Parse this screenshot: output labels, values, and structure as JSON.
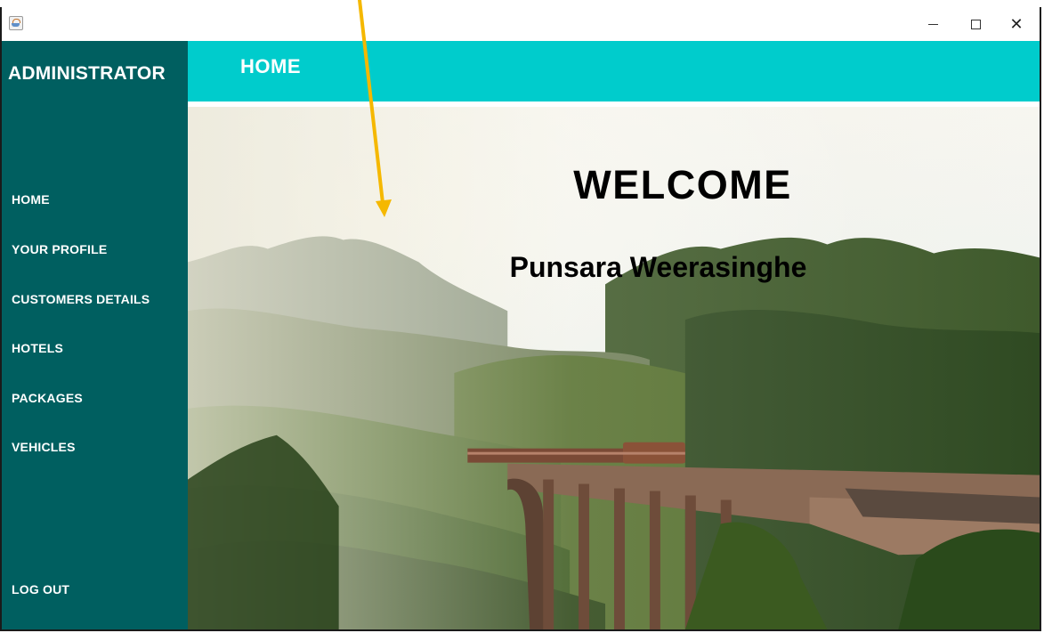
{
  "window": {
    "app_icon": "java-cup-icon",
    "controls": {
      "minimize_icon": "minimize-icon",
      "maximize_icon": "maximize-icon",
      "close_icon": "close-icon",
      "close_glyph": "✕"
    }
  },
  "sidebar": {
    "title": "ADMINISTRATOR",
    "items": [
      {
        "label": "HOME"
      },
      {
        "label": "YOUR PROFILE"
      },
      {
        "label": "CUSTOMERS DETAILS"
      },
      {
        "label": "HOTELS"
      },
      {
        "label": "PACKAGES"
      },
      {
        "label": "VEHICLES"
      }
    ],
    "logout_label": "LOG OUT"
  },
  "header": {
    "title": "HOME"
  },
  "main": {
    "welcome_text": "WELCOME",
    "user_name": "Punsara Weerasinghe",
    "background_image": "train-on-arched-bridge-through-forest-photo"
  },
  "colors": {
    "sidebar_bg": "#005f60",
    "header_bg": "#00cccc",
    "annotation_arrow": "#f5b800"
  }
}
